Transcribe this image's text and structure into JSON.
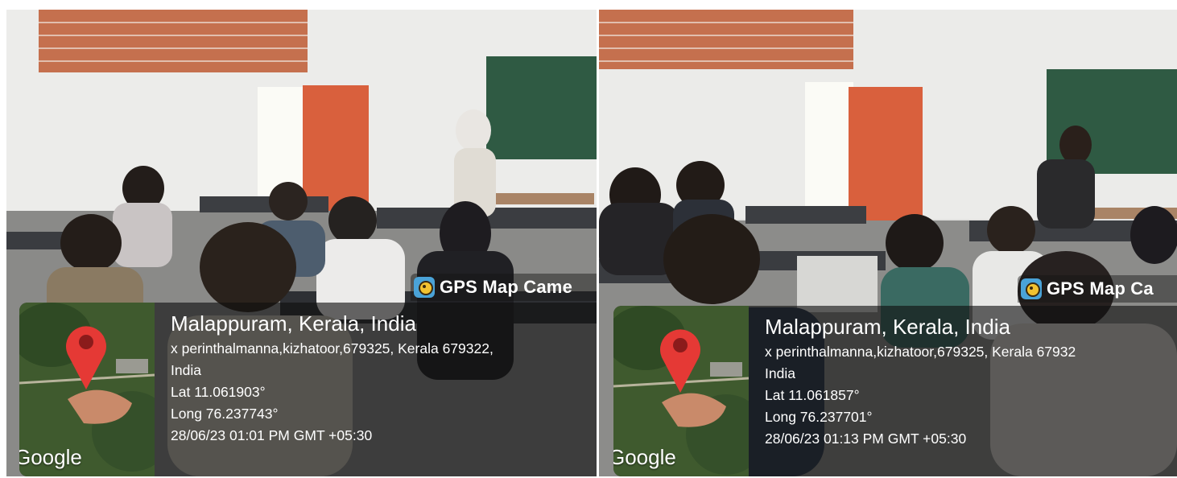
{
  "photos": [
    {
      "brand": "GPS Map Came",
      "map_label": "Google",
      "place": "Malappuram, Kerala, India",
      "address_line1": "x perinthalmanna,kizhatoor,679325, Kerala 679322,",
      "address_line2": "India",
      "lat": "Lat 11.061903°",
      "long": "Long 76.237743°",
      "datetime": "28/06/23 01:01 PM GMT +05:30"
    },
    {
      "brand": "GPS Map Ca",
      "map_label": "Google",
      "place": "Malappuram, Kerala, India",
      "address_line1": "x perinthalmanna,kizhatoor,679325, Kerala 67932",
      "address_line2": "India",
      "lat": "Lat 11.061857°",
      "long": "Long 76.237701°",
      "datetime": "28/06/23 01:13 PM GMT +05:30"
    }
  ],
  "icons": {
    "brand": "gps-map-camera-icon",
    "pin": "map-pin-icon"
  },
  "colors": {
    "pin": "#e53935",
    "chalkboard": "#2f5a43",
    "door": "#d9603d"
  }
}
